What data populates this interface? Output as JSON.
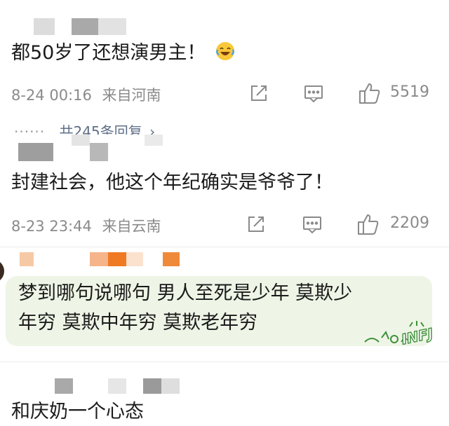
{
  "comments": [
    {
      "text": "都50岁了还想演男主！",
      "emoji": "laughing-crying-emoji",
      "date": "8-24 00:16",
      "location": "来自河南",
      "likes": "5519",
      "replies": "共245条回复"
    },
    {
      "text": "封建社会，他这个年纪确实是爷爷了！",
      "date": "8-23 23:44",
      "location": "来自云南",
      "likes": "2209"
    },
    {
      "text_line1": "梦到哪句说哪句 男人至死是少年 莫欺少",
      "text_line2": "年穷 莫欺中年穷 莫欺老年穷",
      "sticker": "INFJ"
    },
    {
      "text": "和庆奶一个心态"
    }
  ],
  "colors": {
    "meta_text": "#8a8a8a",
    "reply_link": "#5f6f88",
    "highlight_bg": "#eef5e6",
    "orange_accent": "#f07a24"
  },
  "icons": [
    "share-icon",
    "comment-icon",
    "like-icon"
  ]
}
